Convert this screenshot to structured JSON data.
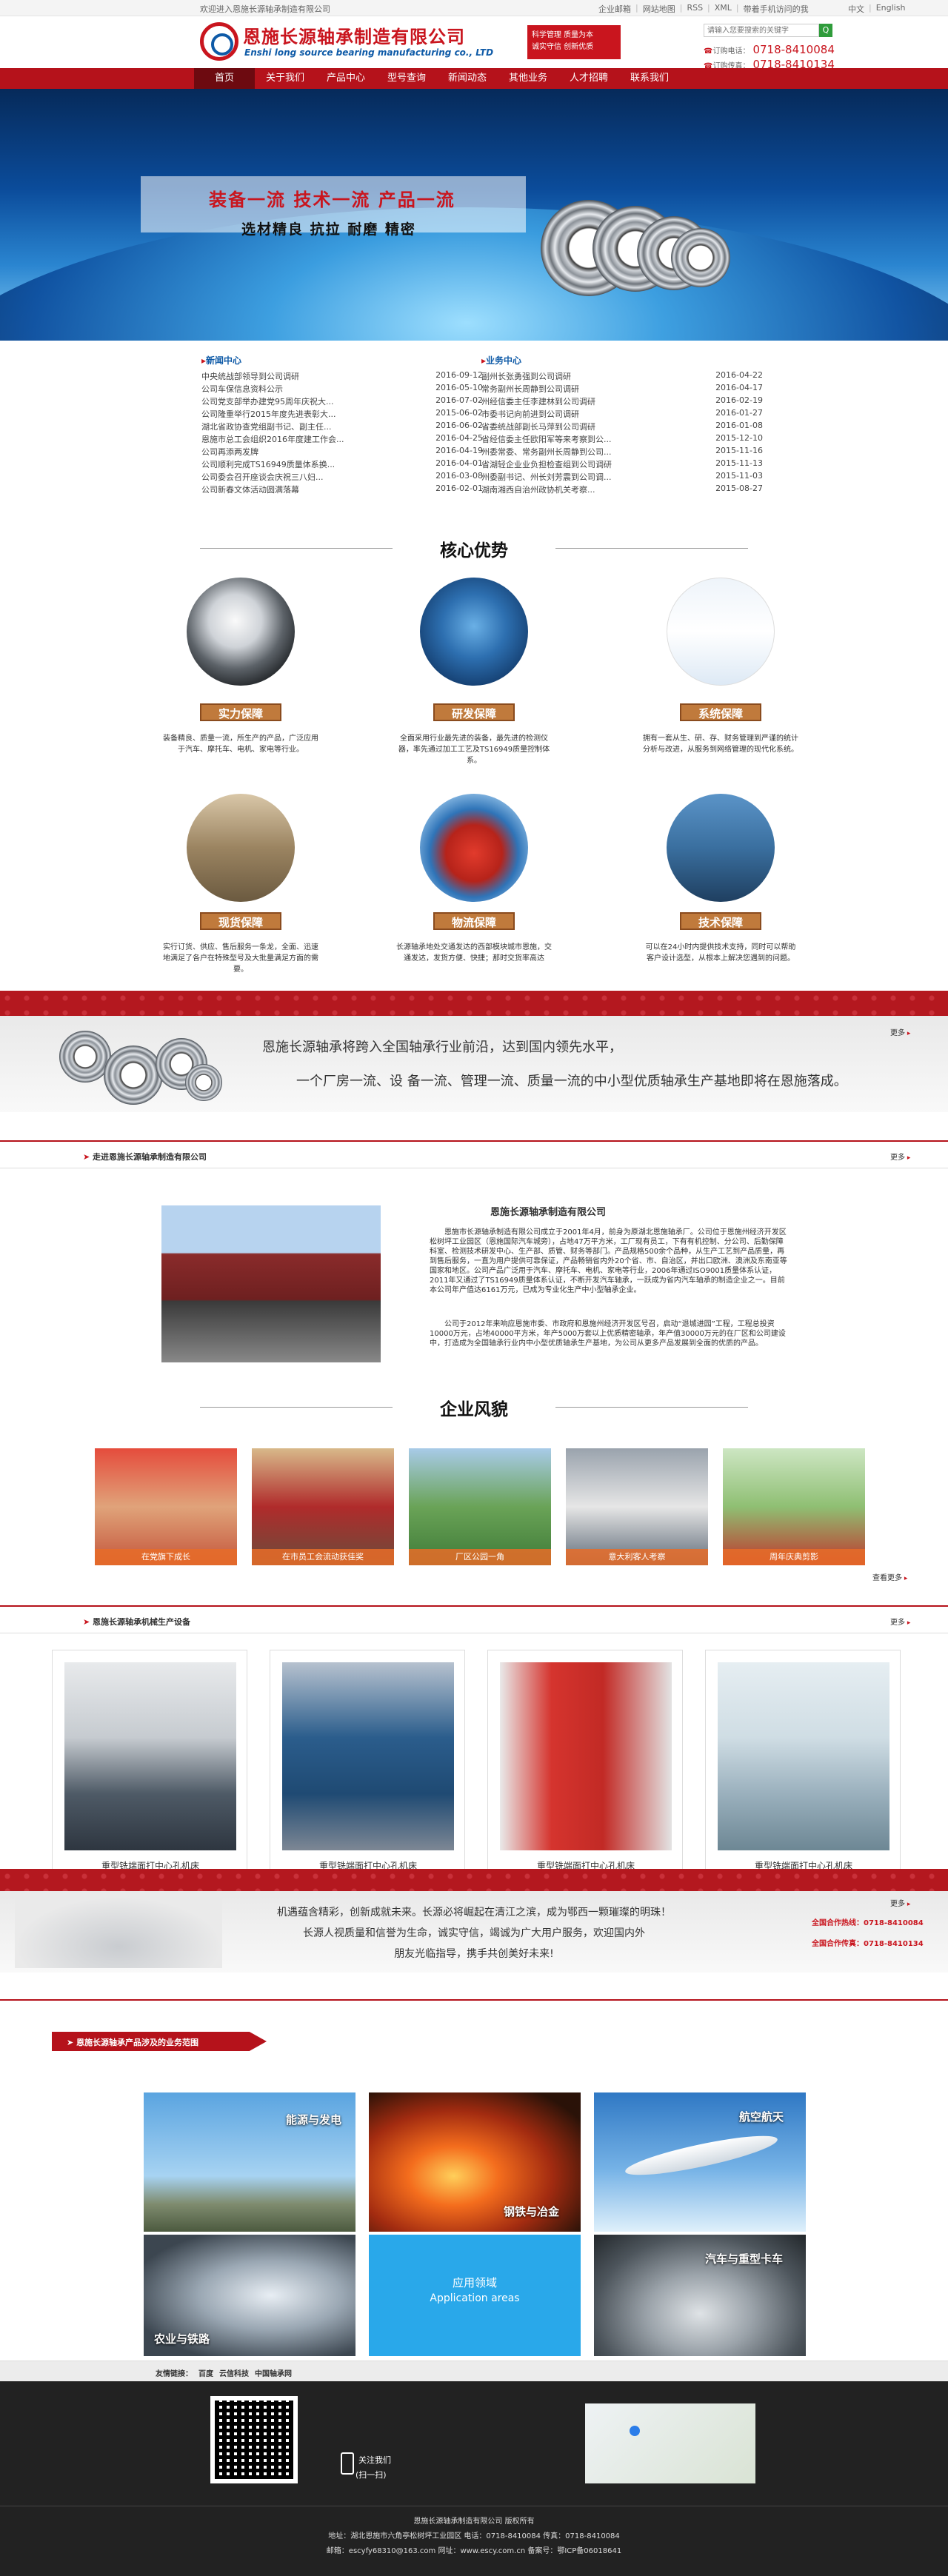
{
  "topbar": {
    "welcome": "欢迎进入恩施长源轴承制造有限公司",
    "links": [
      "企业邮箱",
      "网站地图",
      "RSS",
      "XML",
      "带着手机访问的我"
    ],
    "lang": [
      "中文",
      "English"
    ]
  },
  "header": {
    "company_cn": "恩施长源轴承制造有限公司",
    "company_en": "Enshi long source bearing manufacturing co., LTD",
    "slogan": [
      "科学管理 质量为本",
      "诚实守信 创新优质"
    ],
    "search_placeholder": "请输入您要搜索的关键字",
    "search_btn": "Q",
    "phone_label_1": "订购电话：",
    "phone_1": "0718-8410084",
    "phone_label_2": "订购传真：",
    "phone_2": "0718-8410134"
  },
  "nav": [
    "首页",
    "关于我们",
    "产品中心",
    "型号查询",
    "新闻动态",
    "其他业务",
    "人才招聘",
    "联系我们"
  ],
  "banner": {
    "line1": "装备一流  技术一流  产品一流",
    "line2": "选材精良  抗拉  耐磨  精密"
  },
  "news": {
    "title": "新闻中心",
    "items": [
      {
        "t": "中央统战部领导到公司调研",
        "d": "2016-09-12"
      },
      {
        "t": "公司车保信息资料公示",
        "d": "2016-05-10"
      },
      {
        "t": "公司党支部举办建党95周年庆祝大...",
        "d": "2016-07-02"
      },
      {
        "t": "公司隆重举行2015年度先进表彰大...",
        "d": "2015-06-02"
      },
      {
        "t": "湖北省政协查党组副书记、副主任...",
        "d": "2016-06-02"
      },
      {
        "t": "恩施市总工会组织2016年度建工作会...",
        "d": "2016-04-25"
      },
      {
        "t": "公司再添两发牌",
        "d": "2016-04-19"
      },
      {
        "t": "公司顺利完成TS16949质量体系换...",
        "d": "2016-04-01"
      },
      {
        "t": "公司委会召开座谈会庆祝三八妇...",
        "d": "2016-03-08"
      },
      {
        "t": "公司新春文体活动圆满落幕",
        "d": "2016-02-01"
      }
    ]
  },
  "business": {
    "title": "业务中心",
    "items": [
      {
        "t": "副州长张勇强到公司调研",
        "d": "2016-04-22"
      },
      {
        "t": "常务副州长周静到公司调研",
        "d": "2016-04-17"
      },
      {
        "t": "州经信委主任李建林到公司调研",
        "d": "2016-02-19"
      },
      {
        "t": "市委书记向前进到公司调研",
        "d": "2016-01-27"
      },
      {
        "t": "省委统战部副长马萍到公司调研",
        "d": "2016-01-08"
      },
      {
        "t": "省经信委主任欧阳军等来考察到公...",
        "d": "2015-12-10"
      },
      {
        "t": "州委常委、常务副州长周静到公司...",
        "d": "2015-11-16"
      },
      {
        "t": "省湖轻企业业负担检查组到公司调研",
        "d": "2015-11-13"
      },
      {
        "t": "州委副书记、州长刘芳震到公司调...",
        "d": "2015-11-03"
      },
      {
        "t": "湖南湘西自治州政协机关考察...",
        "d": "2015-08-27"
      }
    ]
  },
  "core": {
    "title": "核心优势",
    "items": [
      {
        "tag": "实力保障",
        "text": "装备精良、质量一流，所生产的产品，广泛应用于汽车、摩托车、电机、家电等行业。"
      },
      {
        "tag": "研发保障",
        "text": "全面采用行业最先进的装备，最先进的检测仪器，率先通过加工工艺及TS16949质量控制体系。"
      },
      {
        "tag": "系统保障",
        "text": "拥有一套从生、研、存、财务管理到严谨的统计分析与改进，从服务到网络管理的现代化系统。"
      },
      {
        "tag": "现货保障",
        "text": "实行订货、供应、售后服务一条龙，全面、迅速地满足了各户在特殊型号及大批量满足方面的需要。"
      },
      {
        "tag": "物流保障",
        "text": "长源轴承地处交通发达的西部模块城市恩施，交通发达，发货方便、快捷；那时交货率高达"
      },
      {
        "tag": "技术保障",
        "text": "可以在24小时内提供技术支持，同时可以帮助客户设计选型，从根本上解决您遇到的问题。"
      }
    ]
  },
  "slogan_band": {
    "line1": "恩施长源轴承将跨入全国轴承行业前沿，达到国内领先水平，",
    "line2": "一个厂房一流、设 备一流、管理一流、质量一流的中小型优质轴承生产基地即将在恩施落成。",
    "more": "更多"
  },
  "about": {
    "header": "走进恩施长源轴承制造有限公司",
    "more": "更多",
    "title": "恩施长源轴承制造有限公司",
    "p1": "恩施市长源轴承制造有限公司成立于2001年4月，前身为原湖北恩施轴承厂。公司位于恩施州经济开发区松树坪工业园区（恩施国际汽车城旁），占地47万平方米，工厂现有员工，下有有机控制、分公司、后勤保障科室、检测技术研发中心、生产部、质管、财务等部门。产品规格500余个品种，从生产工艺到产品质量，再到售后服务，一直为用户提供可靠保证，产品畅销省内外20个省、市、自治区，并出口欧洲、澳洲及东南亚等国家和地区。公司产品广泛用于汽车、摩托车、电机、家电等行业，2006年通过ISO9001质量体系认证，2011年又通过了TS16949质量体系认证，不断开发汽车轴承，一跃成为省内汽车轴承的制造企业之一。目前本公司年产值达6161万元，已成为专业化生产中小型轴承企业。",
    "p2": "公司于2012年来响应恩施市委、市政府和恩施州经济开发区号召，启动“退城进园”工程，工程总投资10000万元，占地40000平方米，年产5000万套以上优质精密轴承，年产值30000万元的在厂区和公司建设中，打造成为全国轴承行业内中小型优质轴承生产基地，为公司从更多产品发展到全面的优质的产品。"
  },
  "style": {
    "title": "企业风貌",
    "captions": [
      "在党旗下成长",
      "在市员工会流动获佳奖",
      "厂区公园一角",
      "意大利客人考察",
      "周年庆典剪影"
    ],
    "more": "查看更多"
  },
  "equip": {
    "header": "恩施长源轴承机械生产设备",
    "more": "更多",
    "items": [
      "重型铣端面打中心孔机床",
      "重型铣端面打中心孔机床",
      "重型铣端面打中心孔机床",
      "重型铣端面打中心孔机床"
    ]
  },
  "motto": {
    "line1": "机遇蕴含精彩，创新成就未来。长源必将崛起在清江之滨，成为鄂西一颗璀璨的明珠！",
    "line2": "长源人视质量和信誉为生命，诚实守信，竭诚为广大用户服务，欢迎国内外",
    "line3": "朋友光临指导，携手共创美好未来!",
    "more": "更多",
    "hotline_label": "全国合作热线：",
    "hotline": "0718-8410084",
    "fax_label": "全国合作传真：",
    "fax": "0718-8410134"
  },
  "apps": {
    "header": "恩施长源轴承产品涉及的业务范围",
    "tiles": [
      {
        "label": "能源与发电"
      },
      {
        "label": "钢铁与冶金"
      },
      {
        "label": "航空航天"
      },
      {
        "label": "农业与铁路"
      },
      {
        "label": "应用领域",
        "sub": "Application areas"
      },
      {
        "label": "汽车与重型卡车"
      }
    ]
  },
  "links": {
    "label": "友情链接：",
    "items": [
      "百度",
      "云信科技",
      "中国轴承网"
    ]
  },
  "footer": {
    "follow": "关注我们",
    "scan": "(扫一扫)",
    "company": "恩施长源轴承制造有限公司 版权所有",
    "address": "地址：湖北恩施市六角亭松树坪工业园区 电话：0718-8410084 传真：0718-8410084",
    "email": "邮箱：escyfy68310@163.com 网址：www.escy.com.cn 备案号：鄂ICP备06018641"
  },
  "colors": {
    "brand_red": "#b5121b",
    "brand_blue": "#0e5aa7",
    "accent_orange": "#e86c28"
  }
}
